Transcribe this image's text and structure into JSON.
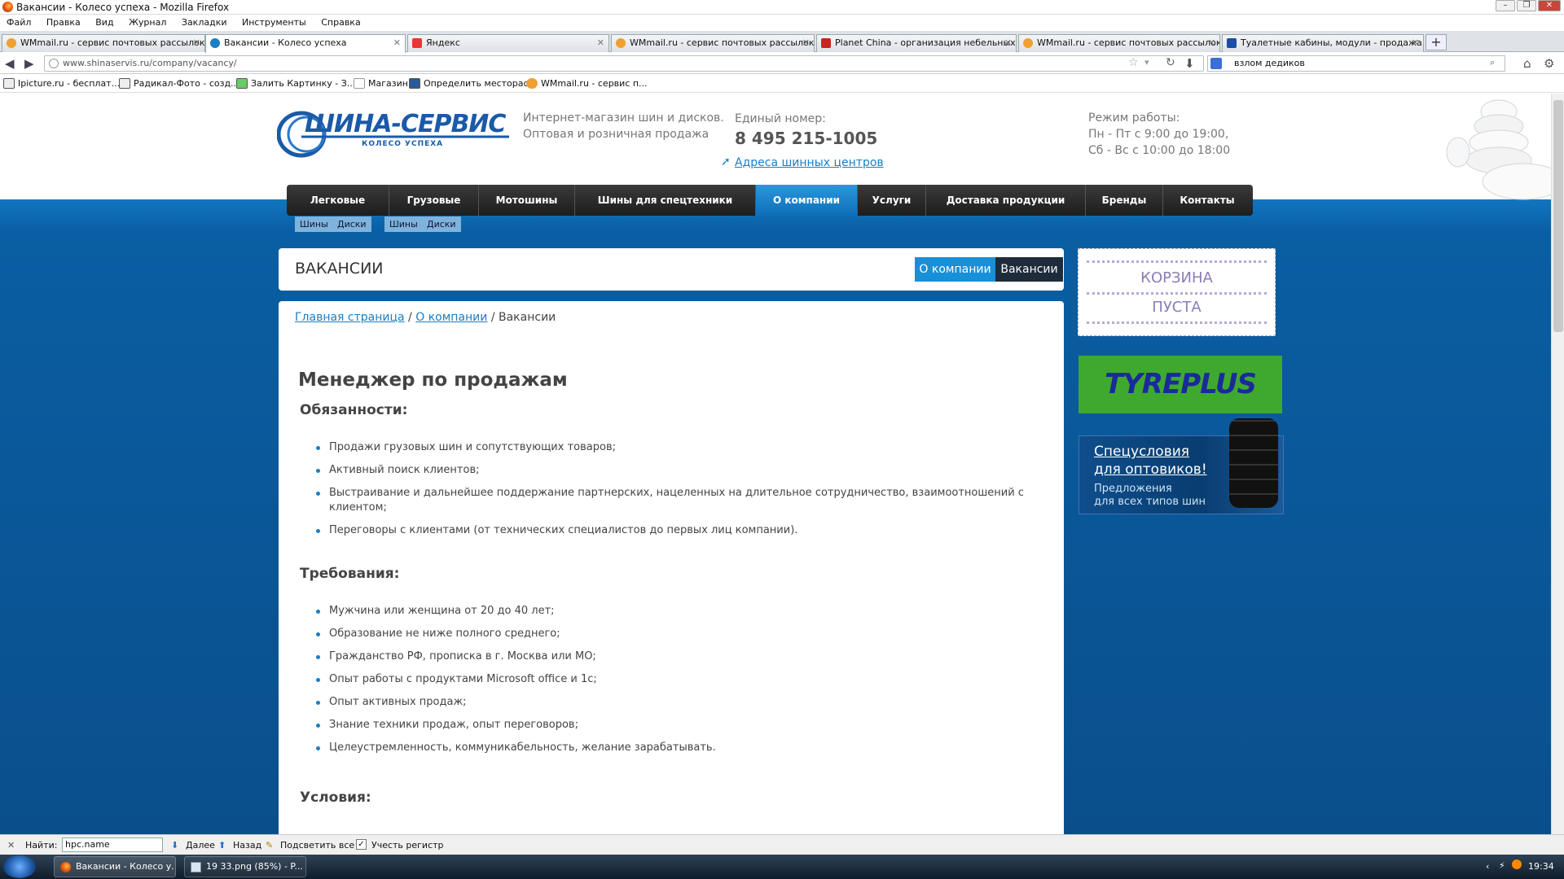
{
  "window": {
    "title": "Вакансии - Колесо успеха - Mozilla Firefox"
  },
  "menu": [
    "Файл",
    "Правка",
    "Вид",
    "Журнал",
    "Закладки",
    "Инструменты",
    "Справка"
  ],
  "tabs": [
    {
      "label": "WMmail.ru - сервис почтовых рассылок..."
    },
    {
      "label": "Вакансии - Колесо успеха"
    },
    {
      "label": "Яндекс"
    },
    {
      "label": "WMmail.ru - сервис почтовых рассылок..."
    },
    {
      "label": "Planet China - организация небельных ..."
    },
    {
      "label": "WMmail.ru - сервис почтовых рассылок..."
    },
    {
      "label": "Туалетные кабины, модули - продажа..."
    }
  ],
  "nav": {
    "url": "www.shinaservis.ru/company/vacancy/",
    "search": "взлом дедиков"
  },
  "bookmarks": [
    "Ipicture.ru - бесплат...",
    "Радикал-Фото - созд...",
    "Залить Картинку - З...",
    "Магазин",
    "Определить месторас...",
    "WMmail.ru - сервис п..."
  ],
  "site": {
    "logo_main": "ШИНА-СЕРВИС",
    "logo_sub": "КОЛЕСО УСПЕХА",
    "tagline1": "Интернет-магазин шин и дисков.",
    "tagline2": "Оптовая и розничная продажа",
    "phone_label": "Единый номер:",
    "phone": "8 495 215-1005",
    "address_link": "Адреса шинных центров",
    "hours_label": "Режим работы:",
    "hours1": "Пн - Пт с 9:00 до 19:00,",
    "hours2": "Сб - Вс с 10:00 до 18:00"
  },
  "topmenu": [
    "Легковые",
    "Грузовые",
    "Мотошины",
    "Шины для спецтехники",
    "О компании",
    "Услуги",
    "Доставка продукции",
    "Бренды",
    "Контакты"
  ],
  "submenu": {
    "a1": "Шины",
    "a2": "Диски",
    "b1": "Шины",
    "b2": "Диски"
  },
  "header": {
    "title": "ВАКАНСИИ",
    "btn_company": "О компании",
    "btn_vacancies": "Вакансии"
  },
  "breadcrumb": {
    "home": "Главная страница",
    "sep1": " / ",
    "company": "О компании",
    "sep2": " / ",
    "current": "Вакансии"
  },
  "vacancy": {
    "title": "Менеджер по продажам",
    "duties_title": "Обязанности:",
    "duties": [
      "Продажи грузовых шин и сопутствующих товаров;",
      "Активный поиск клиентов;",
      "Выстраивание и дальнейшее поддержание партнерских, нацеленных на длительное сотрудничество, взаимоотношений с клиентом;",
      "Переговоры с клиентами (от технических специалистов  до первых лиц компании)."
    ],
    "req_title": "Требования:",
    "requirements": [
      "Мужчина или женщина от 20 до 40 лет;",
      "Образование не ниже полного среднего;",
      "Гражданство РФ, прописка  в г. Москва или МО;",
      "Опыт работы с продуктами Microsoft office и 1с;",
      "Опыт активных продаж;",
      "Знание техники продаж, опыт переговоров;",
      "Целеустремленность, коммуникабельность, желание зарабатывать."
    ],
    "cond_title": "Условия:"
  },
  "sidebar": {
    "cart1": "КОРЗИНА",
    "cart2": "ПУСТА",
    "tyre_brand": "TYREPLUS",
    "spec_title1": "Спецусловия",
    "spec_title2": "для оптовиков!",
    "spec_text1": "Предложения",
    "spec_text2": "для всех типов шин"
  },
  "findbar": {
    "label": "Найти:",
    "value": "hpc.name",
    "next": "Далее",
    "prev": "Назад",
    "highlight": "Подсветить все",
    "case": "Учесть регистр"
  },
  "taskbar": {
    "item1": "Вакансии - Колесо у...",
    "item2": "19 33.png (85%) - P...",
    "clock": "19:34"
  }
}
